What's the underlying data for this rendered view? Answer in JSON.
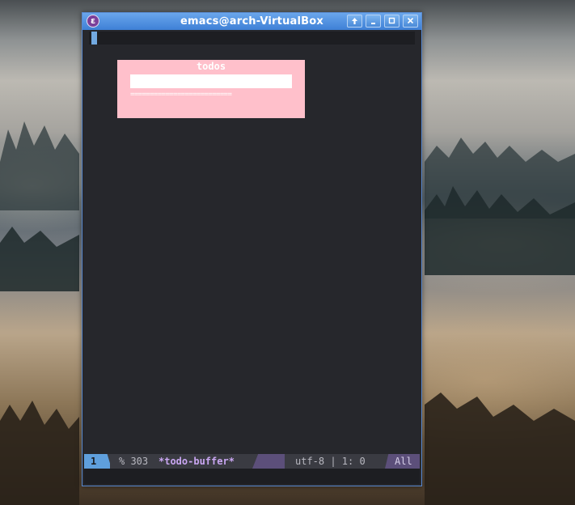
{
  "window": {
    "title": "emacs@arch-VirtualBox",
    "app_icon_glyph": "ε",
    "buttons": [
      "up-arrow-icon",
      "minimize-icon",
      "maximize-icon",
      "close-icon"
    ]
  },
  "todo_panel": {
    "title": "todos",
    "input_value": "",
    "rule": "=========================="
  },
  "modeline": {
    "window_number": "1",
    "status": "% 303",
    "buffer_name": "*todo-buffer*",
    "encoding_position": "utf-8 | 1: 0",
    "scroll": "All"
  },
  "colors": {
    "background": "#26272c",
    "panel": "#ffc0cb",
    "accent": "#5f9fdc",
    "buffer_name": "#c9a6f2",
    "modeline_segment": "#5c4f7a"
  }
}
